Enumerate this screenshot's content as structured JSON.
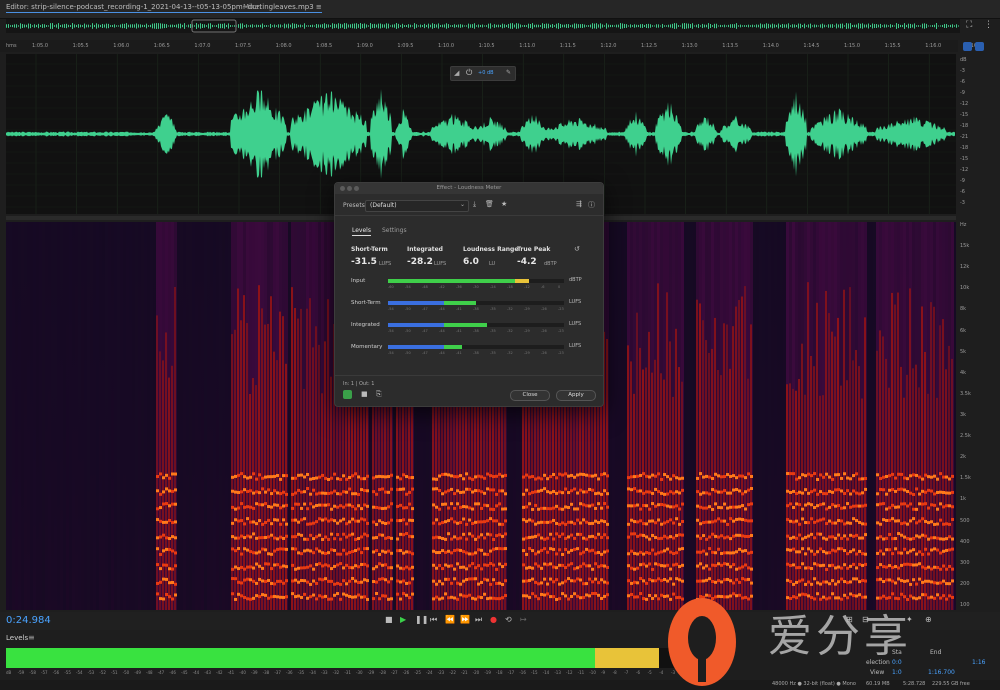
{
  "editor": {
    "tab_label": "Editor: strip-silence-podcast_recording-1_2021-04-13--t05-13-05pm--durtingleaves.mp3",
    "tab_menu": "≡",
    "mixer_label": "Mixer"
  },
  "ruler": {
    "unit": "hms",
    "ticks": [
      "1:05.0",
      "1:05.5",
      "1:06.0",
      "1:06.5",
      "1:07.0",
      "1:07.5",
      "1:08.0",
      "1:08.5",
      "1:09.0",
      "1:09.5",
      "1:10.0",
      "1:10.5",
      "1:11.0",
      "1:11.5",
      "1:12.0",
      "1:12.5",
      "1:13.0",
      "1:13.5",
      "1:14.0",
      "1:14.5",
      "1:15.0",
      "1:15.5",
      "1:16.0",
      "1:16.5"
    ]
  },
  "clip_hud": {
    "gain": "+0 dB"
  },
  "db_scale": [
    "dB",
    "-3",
    "-6",
    "-9",
    "-12",
    "-15",
    "-18",
    "-21",
    "-18",
    "-15",
    "-12",
    "-9",
    "-6",
    "-3"
  ],
  "hz_scale": [
    "Hz",
    "15k",
    "12k",
    "10k",
    "8k",
    "6k",
    "5k",
    "4k",
    "3.5k",
    "3k",
    "2.5k",
    "2k",
    "1.5k",
    "1k",
    "500",
    "400",
    "300",
    "200",
    "100"
  ],
  "transport": {
    "timecode": "0:24.984"
  },
  "levels_panel": {
    "title": "Levels",
    "menu": "≡",
    "green_fraction": 0.83,
    "yellow_fraction": 0.09,
    "ticks": [
      "dB",
      "-59",
      "-58",
      "-57",
      "-56",
      "-55",
      "-54",
      "-53",
      "-52",
      "-51",
      "-50",
      "-49",
      "-48",
      "-47",
      "-46",
      "-45",
      "-44",
      "-43",
      "-42",
      "-41",
      "-40",
      "-39",
      "-38",
      "-37",
      "-36",
      "-35",
      "-34",
      "-33",
      "-32",
      "-31",
      "-30",
      "-29",
      "-28",
      "-27",
      "-26",
      "-25",
      "-24",
      "-23",
      "-22",
      "-21",
      "-20",
      "-19",
      "-18",
      "-17",
      "-16",
      "-15",
      "-14",
      "-13",
      "-12",
      "-11",
      "-10",
      "-9",
      "-8",
      "-7",
      "-6",
      "-5",
      "-4",
      "-3",
      "-2",
      "-1",
      "0"
    ]
  },
  "selection_view": {
    "start_label": "Sta",
    "end_label": "End",
    "selection_label": "election",
    "view_label": "View",
    "selection_start": "0:0",
    "view_start": "1:0",
    "selection_end": "",
    "view_end": "1:16.700",
    "view_end2": "1:16"
  },
  "status_bar": {
    "sample_info": "48000 Hz ● 32-bit (float) ● Mono",
    "size": "60.19 MB",
    "duration": "5:28.728",
    "free": "229.55 GB free"
  },
  "watermark": {
    "text": "爱分享"
  },
  "dialog": {
    "title": "Effect - Loudness Meter",
    "presets_label": "Presets:",
    "presets_value": "(Default)",
    "tabs": [
      "Levels",
      "Settings"
    ],
    "meters": [
      {
        "label": "Short-Term",
        "value": "-31.5",
        "unit": "LUFS"
      },
      {
        "label": "Integrated",
        "value": "-28.2",
        "unit": "LUFS"
      },
      {
        "label": "Loudness Range",
        "value": "6.0",
        "unit": "LU"
      },
      {
        "label": "True Peak",
        "value": "-4.2",
        "unit": "dBTP"
      }
    ],
    "rows": [
      {
        "label": "Input",
        "unit": "dBTP",
        "blue": 0,
        "green": 0.72,
        "yellow": 0.08,
        "ticks": [
          "-60",
          "-54",
          "-48",
          "-42",
          "-36",
          "-30",
          "-24",
          "-18",
          "-12",
          "-6",
          "0"
        ]
      },
      {
        "label": "Short-Term",
        "unit": "LUFS",
        "blue": 0.32,
        "green": 0.18,
        "yellow": 0,
        "ticks": [
          "-54",
          "-50",
          "-47",
          "-44",
          "-41",
          "-38",
          "-35",
          "-32",
          "-29",
          "-26",
          "-23"
        ]
      },
      {
        "label": "Integrated",
        "unit": "LUFS",
        "blue": 0.32,
        "green": 0.24,
        "yellow": 0,
        "ticks": [
          "-54",
          "-50",
          "-47",
          "-44",
          "-41",
          "-38",
          "-35",
          "-32",
          "-29",
          "-26",
          "-23"
        ]
      },
      {
        "label": "Momentary",
        "unit": "LUFS",
        "blue": 0.32,
        "green": 0.1,
        "yellow": 0,
        "ticks": [
          "-54",
          "-50",
          "-47",
          "-44",
          "-41",
          "-38",
          "-35",
          "-32",
          "-29",
          "-26",
          "-23"
        ]
      }
    ],
    "io_label": "In: 1 | Out: 1",
    "close_label": "Close",
    "apply_label": "Apply"
  }
}
